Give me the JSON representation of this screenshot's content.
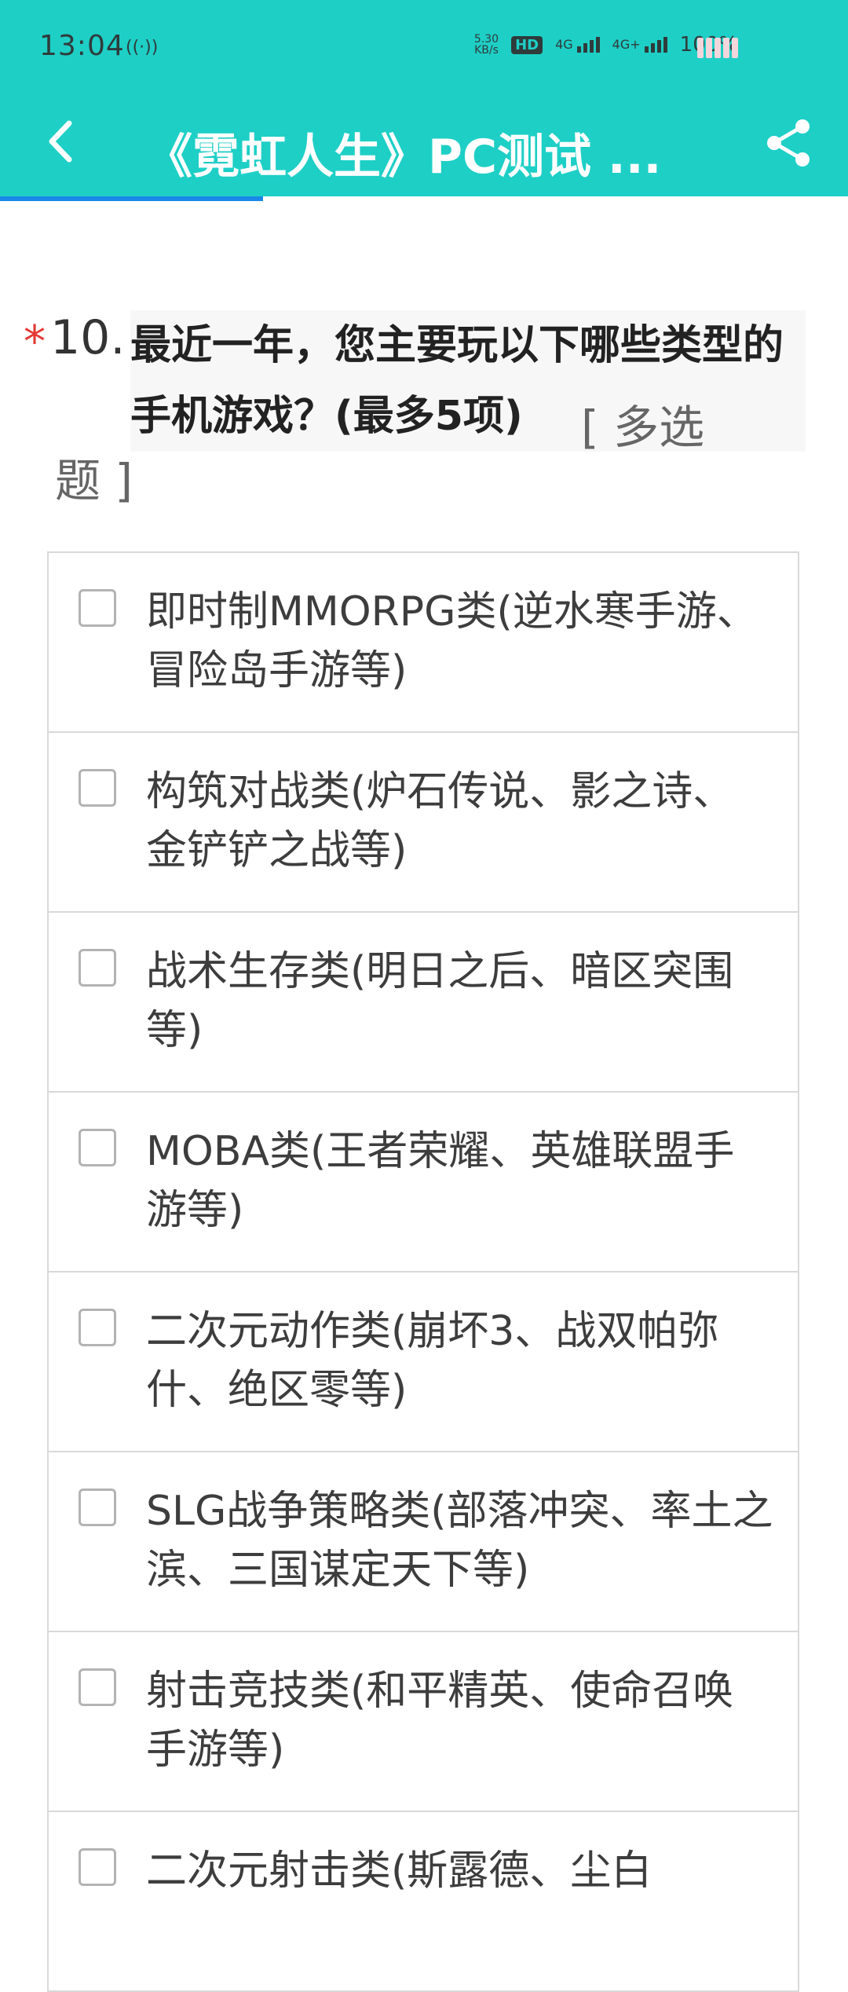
{
  "status": {
    "time": "13:04",
    "hotspot_icon": "hotspot-icon",
    "net_speed_value": "5.30",
    "net_speed_unit": "KB/s",
    "hd_label": "HD",
    "sim1_label": "4G",
    "sim2_label": "4G+",
    "battery_pct": "100%"
  },
  "appbar": {
    "title": "《霓虹人生》PC测试 ...",
    "progress_fraction": 0.31
  },
  "question": {
    "required_mark": "*",
    "number": "10.",
    "text": "最近一年，您主要玩以下哪些类型的手机游戏？(最多5项)",
    "type_start": "[ 多选",
    "type_end": "题 ]"
  },
  "options": [
    {
      "label": "即时制MMORPG类(逆水寒手游、冒险岛手游等)"
    },
    {
      "label": "构筑对战类(炉石传说、影之诗、金铲铲之战等)"
    },
    {
      "label": "战术生存类(明日之后、暗区突围等)"
    },
    {
      "label": "MOBA类(王者荣耀、英雄联盟手游等)"
    },
    {
      "label": "二次元动作类(崩坏3、战双帕弥什、绝区零等)"
    },
    {
      "label": "SLG战争策略类(部落冲突、率土之滨、三国谋定天下等)"
    },
    {
      "label": "射击竞技类(和平精英、使命召唤手游等)"
    },
    {
      "label": "二次元射击类(斯露德、尘白"
    }
  ]
}
